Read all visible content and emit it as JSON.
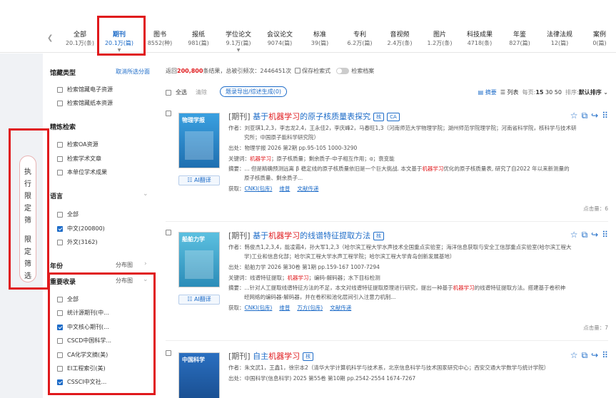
{
  "tabs": [
    {
      "label": "全部",
      "count": "20.1万(条)",
      "active": false
    },
    {
      "label": "期刊",
      "count": "20.1万(篇)",
      "active": true
    },
    {
      "label": "图书",
      "count": "8552(种)",
      "active": false
    },
    {
      "label": "报纸",
      "count": "981(篇)",
      "active": false
    },
    {
      "label": "学位论文",
      "count": "9.1万(篇)",
      "active": false
    },
    {
      "label": "会议论文",
      "count": "9074(篇)",
      "active": false
    },
    {
      "label": "标准",
      "count": "39(篇)",
      "active": false
    },
    {
      "label": "专利",
      "count": "6.2万(篇)",
      "active": false
    },
    {
      "label": "音视频",
      "count": "2.4万(条)",
      "active": false
    },
    {
      "label": "图片",
      "count": "1.2万(条)",
      "active": false
    },
    {
      "label": "科技成果",
      "count": "4718(条)",
      "active": false
    },
    {
      "label": "年鉴",
      "count": "827(篇)",
      "active": false
    },
    {
      "label": "法律法规",
      "count": "12(篇)",
      "active": false
    },
    {
      "label": "案例",
      "count": "0(篇)",
      "active": false
    }
  ],
  "left_strip": {
    "chars": [
      "执",
      "行",
      "限",
      "定",
      "筛",
      "限",
      "定",
      "筛",
      "选"
    ]
  },
  "filters": {
    "collection": {
      "title": "馆藏类型",
      "cancel": "取消所选分面",
      "items": [
        {
          "label": "检索馆藏电子资源",
          "checked": false
        },
        {
          "label": "检索馆藏纸本资源",
          "checked": false
        }
      ]
    },
    "refine": {
      "title": "精炼检索",
      "items": [
        {
          "label": "检索OA资源",
          "checked": false
        },
        {
          "label": "检索学术文章",
          "checked": false
        },
        {
          "label": "本单位学术成果",
          "checked": false
        }
      ]
    },
    "language": {
      "title": "语言",
      "items": [
        {
          "label": "全部",
          "checked": false
        },
        {
          "label": "中文(200800)",
          "checked": true
        },
        {
          "label": "外文(3162)",
          "checked": false
        }
      ]
    },
    "year": {
      "title": "年份",
      "dist": "分布图"
    },
    "index": {
      "title": "重要收录",
      "dist": "分布图",
      "items": [
        {
          "label": "全部",
          "checked": false
        },
        {
          "label": "统计源期刊(中...",
          "checked": false
        },
        {
          "label": "中文核心期刊(...",
          "checked": true
        },
        {
          "label": "CSCD中国科学...",
          "checked": false
        },
        {
          "label": "CA化学文摘(美)",
          "checked": false
        },
        {
          "label": "EI工程索引(美)",
          "checked": false
        },
        {
          "label": "CSSCI中文社...",
          "checked": true
        }
      ]
    }
  },
  "summary": {
    "prefix": "返回",
    "count": "200,800",
    "rest": "条结果，总被引频次：2446451次",
    "save": "保存检索式",
    "archive": "检索档案"
  },
  "toolbar": {
    "select_all": "全选",
    "clear": "清除",
    "export": "题录导出/综述生成(0)",
    "view_abstract": "摘要",
    "view_list": "列表",
    "per_page": "每页:",
    "per_page_opts": [
      "15",
      "30",
      "50"
    ],
    "sort_label": "排序:",
    "sort_value": "默认排序"
  },
  "results": [
    {
      "prefix": "[期刊]",
      "title_pre": "基于",
      "title_hl": "机器学习",
      "title_post": "的原子核质量表探究",
      "tags": [
        "核",
        "CA"
      ],
      "ai": "AI翻译",
      "authors": "作者：刘亚琪1,2,3，李志龙2,4，王永佳2，李庆峰2，马春旺1,3（河南师范大学物理学院；湖州师范学院理学院；河南省科学院，核科学与技术研",
      "authors2": "究所；中国原子能科学研究院）",
      "source": "出处：物理学报 2026 第2期 pp.95-105 1000-3290",
      "keywords_pre": "关键词：",
      "keywords_hl": "机器学习",
      "keywords_post": "；原子核质量；剩余质子-中子相互作用；α；衰变能",
      "abstract_pre": "摘要：... 但是精确预测远离 β 稳定线的原子核质量依旧是一个巨大挑战. 本文基于",
      "abstract_hl": "机器学习",
      "abstract_post": "优化的原子核质量表, 研究了自2022 年以来新测量的",
      "abstract2": "原子核质量、剩余质子...",
      "get_label": "获取：",
      "links": [
        "CNKI(包库)",
        "维普",
        "文献传递"
      ],
      "clicks": "点击量：6",
      "cover_color": "#2c8fd6",
      "cover_label": "物理学报"
    },
    {
      "prefix": "[期刊]",
      "title_pre": "基于",
      "title_hl": "机器学习",
      "title_post": "的线谱特征提取方法",
      "tags": [
        "核"
      ],
      "ai": "AI翻译",
      "authors": "作者：韩俊杰1,2,3,4，能凌霜4，孙大军1,2,3（哈尔滨工程大学水声技术全国重点实验室；海洋信息获取与安全工信部重点实验室(哈尔滨工程大",
      "authors2": "学)工业和信息化部；哈尔滨工程大学水声工程学院；哈尔滨工程大学青岛创新发展基地）",
      "source": "出处：船舶力学 2026 第30卷 第1期 pp.159-167 1007-7294",
      "keywords_pre": "关键词：线谱特征提取；",
      "keywords_hl": "机器学习",
      "keywords_post": "；编码-解码器；水下目标检测",
      "abstract_pre": "摘要：...针对人工提取线谱特征方法的不足，本文对线谱特征提取原理进行研究，提出一种基于",
      "abstract_hl": "机器学习",
      "abstract_post": "的线谱特征提取方法。搭建基于卷积神",
      "abstract2": "经网络的编码器-解码器，并在卷积和池化层间引入注意力机制...",
      "get_label": "获取：",
      "links": [
        "CNKI(包库)",
        "维普",
        "万方(包库)",
        "文献传递"
      ],
      "clicks": "点击量：7",
      "cover_color": "#35a3c8",
      "cover_label": "船舶力学"
    },
    {
      "prefix": "[期刊]",
      "title_pre": "自主",
      "title_hl": "机器学习",
      "title_post": "",
      "tags": [
        "核"
      ],
      "authors": "作者：朱文武1，王鑫1，徐宗本2（清华大学计算机科学与技术系，北京信息科学与技术国家研究中心；西安交通大学数学与统计学院）",
      "source": "出处：中国科学(信息科学) 2025 第55卷 第10期 pp.2542-2554 1674-7267",
      "cover_color": "#1d5fa8",
      "cover_label": "中国科学"
    }
  ],
  "result_actions": [
    "☆",
    "⧉",
    "↪",
    "⠿"
  ]
}
